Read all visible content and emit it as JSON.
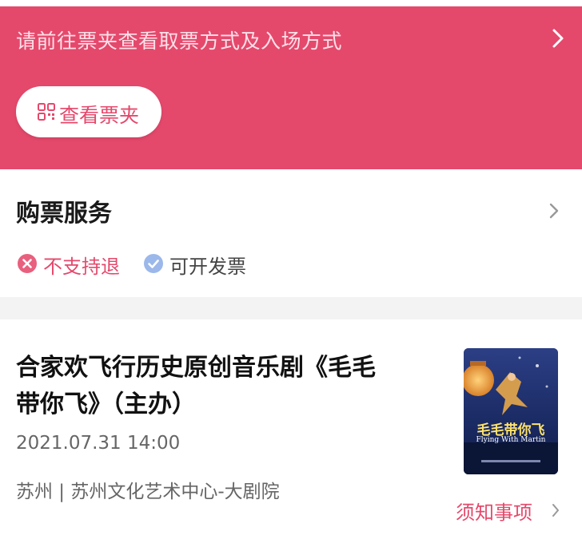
{
  "banner": {
    "text": "请前往票夹查看取票方式及入场方式",
    "button_label": "查看票夹"
  },
  "service": {
    "title": "购票服务",
    "tags": [
      {
        "label": "不支持退",
        "icon": "x-circle-icon",
        "color": "#e4496c"
      },
      {
        "label": "可开发票",
        "icon": "check-circle-icon",
        "color": "#8fb0e8"
      }
    ]
  },
  "event": {
    "title": "合家欢飞行历史原创音乐剧《毛毛带你飞》（主办）",
    "datetime": "2021.07.31 14:00",
    "venue": "苏州 | 苏州文化艺术中心-大剧院",
    "notice_label": "须知事项",
    "poster": {
      "title": "毛毛带你飞",
      "subtitle": "Flying With Martin",
      "icon": "poster-image"
    }
  },
  "colors": {
    "accent": "#e4496c",
    "banner_text": "#ffe0e8",
    "divider": "#f3f3f3"
  }
}
